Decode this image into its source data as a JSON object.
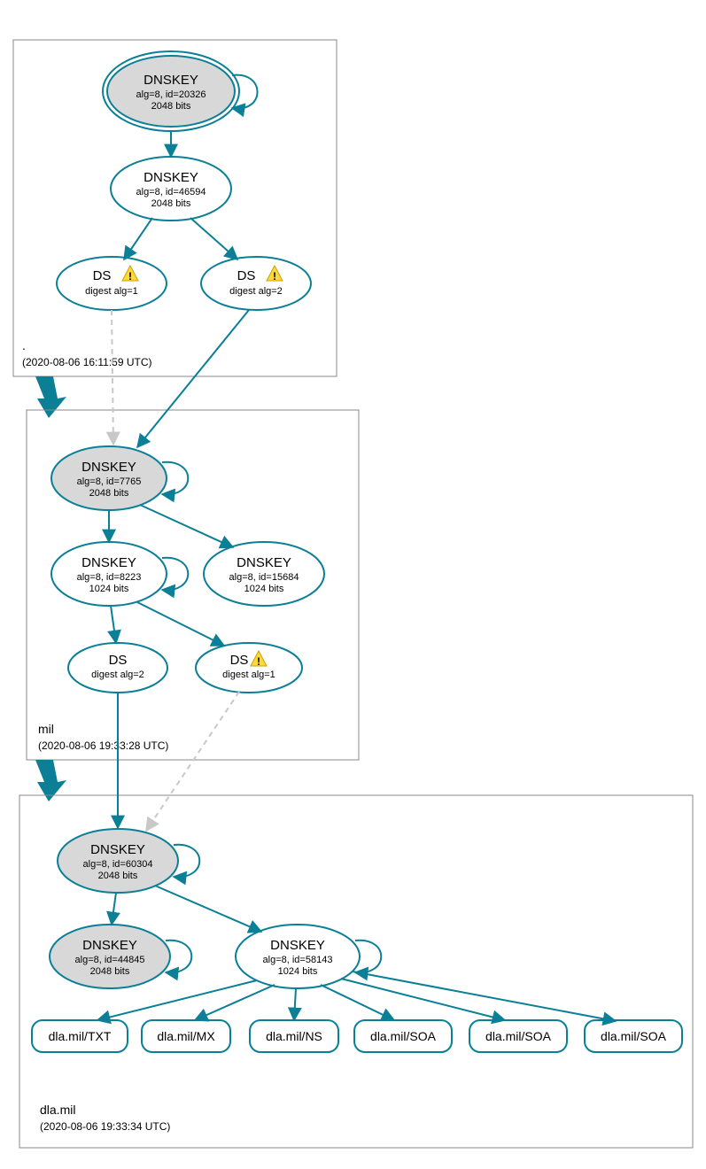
{
  "colors": {
    "accent": "#0a7f96",
    "shade": "#d8d8d8",
    "warn": "#ffd83a"
  },
  "zones": {
    "root": {
      "name": ".",
      "timestamp": "(2020-08-06 16:11:59 UTC)"
    },
    "mil": {
      "name": "mil",
      "timestamp": "(2020-08-06 19:33:28 UTC)"
    },
    "dla": {
      "name": "dla.mil",
      "timestamp": "(2020-08-06 19:33:34 UTC)"
    }
  },
  "nodes": {
    "root_ksk": {
      "title": "DNSKEY",
      "line2": "alg=8, id=20326",
      "line3": "2048 bits"
    },
    "root_zsk": {
      "title": "DNSKEY",
      "line2": "alg=8, id=46594",
      "line3": "2048 bits"
    },
    "root_ds1": {
      "title": "DS",
      "line2": "digest alg=1"
    },
    "root_ds2": {
      "title": "DS",
      "line2": "digest alg=2"
    },
    "mil_ksk": {
      "title": "DNSKEY",
      "line2": "alg=8, id=7765",
      "line3": "2048 bits"
    },
    "mil_zsk": {
      "title": "DNSKEY",
      "line2": "alg=8, id=8223",
      "line3": "1024 bits"
    },
    "mil_zsk2": {
      "title": "DNSKEY",
      "line2": "alg=8, id=15684",
      "line3": "1024 bits"
    },
    "mil_ds2": {
      "title": "DS",
      "line2": "digest alg=2"
    },
    "mil_ds1": {
      "title": "DS",
      "line2": "digest alg=1"
    },
    "dla_ksk": {
      "title": "DNSKEY",
      "line2": "alg=8, id=60304",
      "line3": "2048 bits"
    },
    "dla_zsk2": {
      "title": "DNSKEY",
      "line2": "alg=8, id=44845",
      "line3": "2048 bits"
    },
    "dla_zsk": {
      "title": "DNSKEY",
      "line2": "alg=8, id=58143",
      "line3": "1024 bits"
    },
    "rr_txt": {
      "label": "dla.mil/TXT"
    },
    "rr_mx": {
      "label": "dla.mil/MX"
    },
    "rr_ns": {
      "label": "dla.mil/NS"
    },
    "rr_soa1": {
      "label": "dla.mil/SOA"
    },
    "rr_soa2": {
      "label": "dla.mil/SOA"
    },
    "rr_soa3": {
      "label": "dla.mil/SOA"
    }
  }
}
